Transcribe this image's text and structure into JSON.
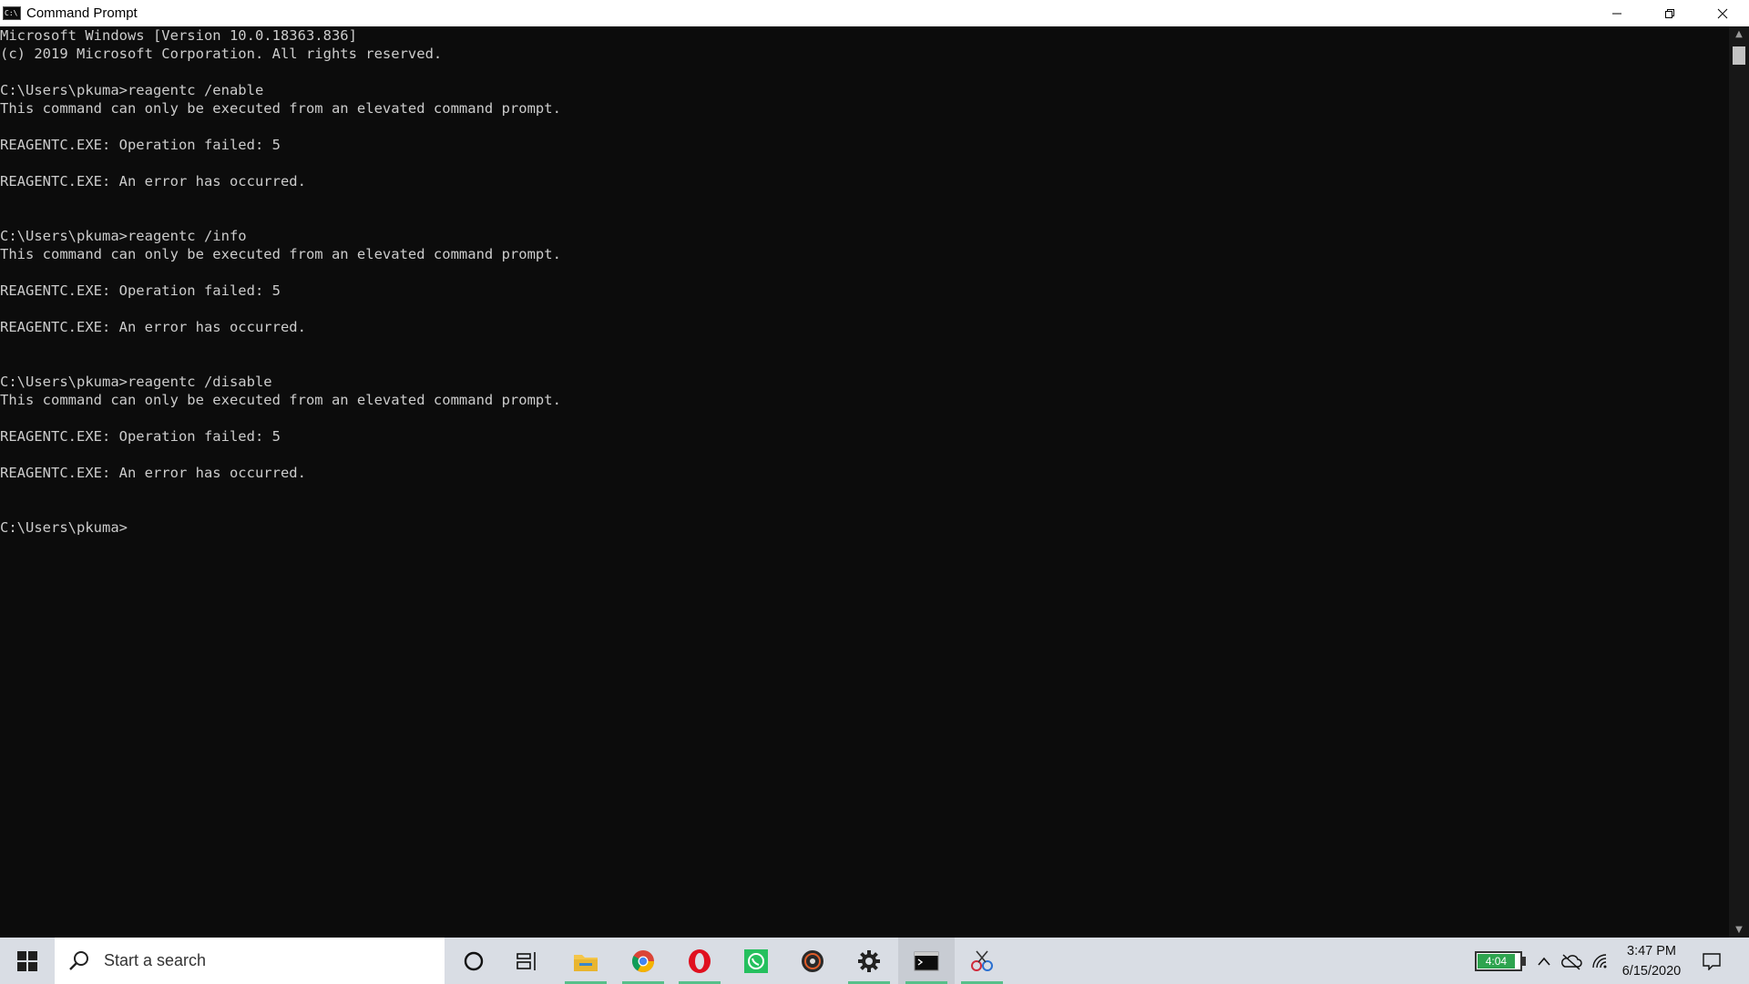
{
  "window": {
    "title": "Command Prompt",
    "app_icon_text": "C:\\",
    "controls": {
      "minimize": "—",
      "restore": "❐",
      "close": "✕"
    }
  },
  "console": {
    "lines": [
      "Microsoft Windows [Version 10.0.18363.836]",
      "(c) 2019 Microsoft Corporation. All rights reserved.",
      "",
      "C:\\Users\\pkuma>reagentc /enable",
      "This command can only be executed from an elevated command prompt.",
      "",
      "REAGENTC.EXE: Operation failed: 5",
      "",
      "REAGENTC.EXE: An error has occurred.",
      "",
      "",
      "C:\\Users\\pkuma>reagentc /info",
      "This command can only be executed from an elevated command prompt.",
      "",
      "REAGENTC.EXE: Operation failed: 5",
      "",
      "REAGENTC.EXE: An error has occurred.",
      "",
      "",
      "C:\\Users\\pkuma>reagentc /disable",
      "This command can only be executed from an elevated command prompt.",
      "",
      "REAGENTC.EXE: Operation failed: 5",
      "",
      "REAGENTC.EXE: An error has occurred.",
      "",
      "",
      "C:\\Users\\pkuma>"
    ]
  },
  "taskbar": {
    "search_placeholder": "Start a search",
    "apps": [
      {
        "name": "cortana-icon",
        "running": false
      },
      {
        "name": "task-view-icon",
        "running": false
      },
      {
        "name": "file-explorer-icon",
        "running": true
      },
      {
        "name": "chrome-icon",
        "running": true
      },
      {
        "name": "opera-icon",
        "running": true
      },
      {
        "name": "whatsapp-icon",
        "running": false
      },
      {
        "name": "music-player-icon",
        "running": false
      },
      {
        "name": "settings-icon",
        "running": true
      },
      {
        "name": "command-prompt-icon",
        "running": true,
        "active": true
      },
      {
        "name": "snipping-tool-icon",
        "running": true
      }
    ],
    "battery": {
      "label": "4:04",
      "level": 0.85
    },
    "clock": {
      "time": "3:47 PM",
      "date": "6/15/2020"
    },
    "colors": {
      "taskbar_bg": "#d9dde4",
      "running_indicator": "#57c08a",
      "console_bg": "#0c0c0c",
      "console_text": "#cccccc"
    }
  }
}
